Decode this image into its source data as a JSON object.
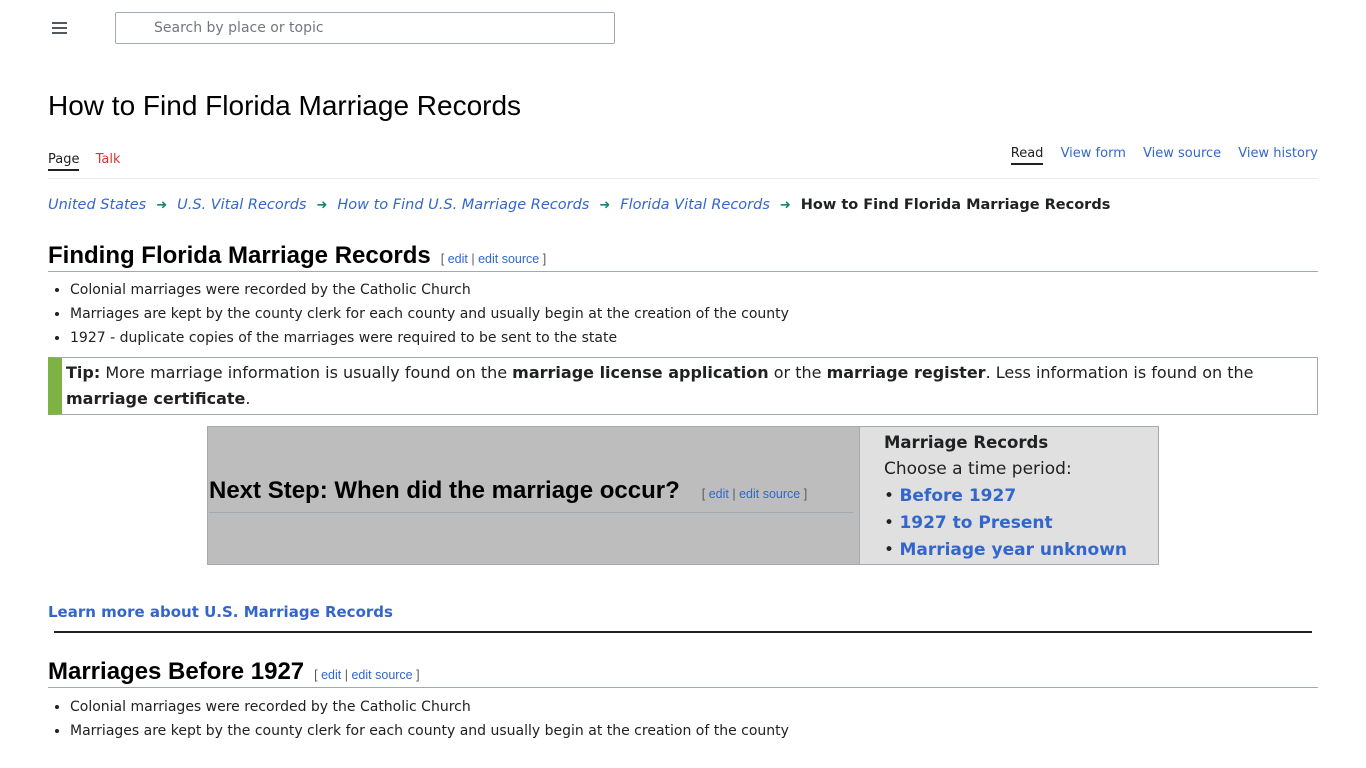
{
  "header": {
    "search_placeholder": "Search by place or topic"
  },
  "page": {
    "title": "How to Find Florida Marriage Records",
    "tabs_left": [
      "Page",
      "Talk"
    ],
    "tabs_right": [
      "Read",
      "View form",
      "View source",
      "View history"
    ]
  },
  "breadcrumb": {
    "items": [
      "United States",
      "U.S. Vital Records",
      "How to Find U.S. Marriage Records",
      "Florida Vital Records"
    ],
    "current": "How to Find Florida Marriage Records"
  },
  "edit_links": {
    "open": "[",
    "edit": "edit",
    "sep": "|",
    "edit_source": "edit source",
    "close": "]"
  },
  "section1": {
    "heading": "Finding Florida Marriage Records",
    "bullets": [
      "Colonial marriages were recorded by the Catholic Church",
      "Marriages are kept by the county clerk for each county and usually begin at the creation of the county",
      "1927 - duplicate copies of the marriages were required to be sent to the state"
    ]
  },
  "tip": {
    "label": "Tip:",
    "text1": " More marriage information is usually found on the ",
    "bold1": "marriage license application",
    "text2": " or the ",
    "bold2": "marriage register",
    "text3": ". Less information is found on the ",
    "bold3": "marriage certificate",
    "text4": "."
  },
  "next_step": {
    "heading": "Next Step: When did the marriage occur?",
    "box_title": "Marriage Records",
    "prompt": "Choose a time period:",
    "options": [
      "Before 1927",
      "1927 to Present",
      "Marriage year unknown"
    ]
  },
  "learn_more": "Learn more about U.S. Marriage Records",
  "section2": {
    "heading": "Marriages Before 1927",
    "bullets": [
      "Colonial marriages were recorded by the Catholic Church",
      "Marriages are kept by the county clerk for each county and usually begin at the creation of the county"
    ]
  },
  "colors": {
    "link": "#3366cc",
    "talk_red": "#dd3333",
    "tip_accent": "#7cb342",
    "breadcrumb_arrow": "#14866d"
  }
}
